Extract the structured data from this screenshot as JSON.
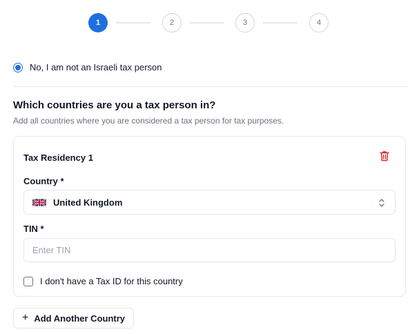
{
  "stepper": {
    "steps": [
      {
        "number": "1",
        "state": "active"
      },
      {
        "number": "2",
        "state": "inactive"
      },
      {
        "number": "3",
        "state": "inactive"
      },
      {
        "number": "4",
        "state": "inactive"
      }
    ]
  },
  "tax_status": {
    "option_label": "No, I am not an Israeli tax person",
    "selected": true
  },
  "section": {
    "title": "Which countries are you a tax person in?",
    "subtitle": "Add all countries where you are considered a tax person for tax purposes."
  },
  "residency": {
    "title": "Tax Residency 1",
    "delete_icon": "trash-icon",
    "country_label": "Country *",
    "country_value": "United Kingdom",
    "country_flag": "uk-flag-icon",
    "tin_label": "TIN *",
    "tin_placeholder": "Enter TIN",
    "tin_value": "",
    "no_tax_id_label": "I don't have a Tax ID for this country",
    "no_tax_id_checked": false
  },
  "actions": {
    "add_country_label": "Add Another Country",
    "add_icon": "plus-icon"
  },
  "colors": {
    "accent": "#1d6fe0",
    "danger": "#dc2626",
    "border": "#e5e7eb",
    "muted_text": "#6b7280"
  }
}
